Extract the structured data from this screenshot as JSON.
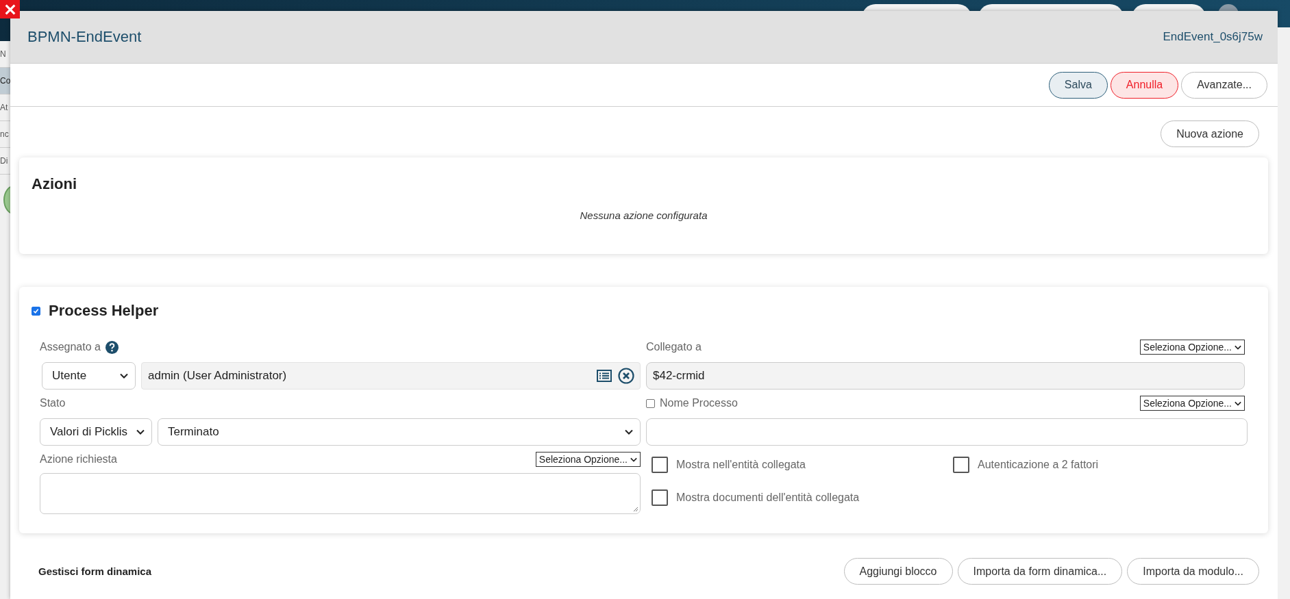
{
  "background": {
    "side_labels": [
      "N",
      "Co",
      "At",
      "nc",
      "Di"
    ]
  },
  "dialog": {
    "title": "BPMN-EndEvent",
    "id": "EndEvent_0s6j75w"
  },
  "toolbar": {
    "buttons": [
      {
        "label": "Salva",
        "kind": "primary"
      },
      {
        "label": "Annulla",
        "kind": "danger"
      },
      {
        "label": "Avanzate...",
        "kind": "default"
      }
    ]
  },
  "new_action_button": "Nuova azione",
  "actions_card": {
    "title": "Azioni",
    "empty_message": "Nessuna azione configurata"
  },
  "process_helper": {
    "enabled": true,
    "title": "Process Helper",
    "assigned_to": {
      "label": "Assegnato a",
      "type": "Utente",
      "value": "admin (User Administrator)"
    },
    "status": {
      "label": "Stato",
      "source": "Valori di Picklis",
      "value": "Terminato"
    },
    "required_action": {
      "label": "Azione richiesta",
      "option": "Seleziona Opzione..."
    },
    "linked_to": {
      "label": "Collegato a",
      "option": "Seleziona Opzione...",
      "value": "$42-crmid"
    },
    "process_name": {
      "label": "Nome Processo",
      "checked": false,
      "option": "Seleziona Opzione..."
    },
    "options": [
      {
        "label": "Mostra nell'entità collegata",
        "checked": false
      },
      {
        "label": "Autenticazione a 2 fattori",
        "checked": false
      },
      {
        "label": "Mostra documenti dell'entità collegata",
        "checked": false
      }
    ]
  },
  "dynamic_form": {
    "title": "Gestisci form dinamica",
    "buttons": [
      "Aggiungi blocco",
      "Importa da form dinamica...",
      "Importa da modulo..."
    ]
  }
}
